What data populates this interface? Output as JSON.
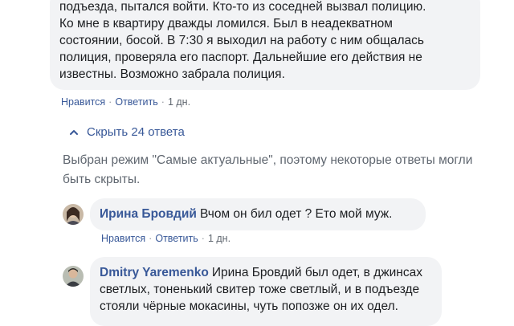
{
  "comment1": {
    "lines": [
      "подъезда, пытался войти. Кто-то из соседней вызвал полицию.",
      "Ко мне в квартиру дважды ломился. Был в неадекватном",
      "состоянии, босой. В 7:30 я выходил на работу с ним общалась",
      "полиция, проверяла его паспорт. Дальнейшие его действия не",
      "известны. Возможно забрала полиция."
    ],
    "like": "Нравится",
    "reply": "Ответить",
    "time": "1 дн."
  },
  "hide_replies": "Скрыть 24 ответа",
  "notice": "Выбран режим \"Самые актуальные\", поэтому некоторые ответы могли быть скрыты.",
  "reply1": {
    "author": "Ирина Бровдий",
    "text": "Вчом он бил одет ? Ето мой муж.",
    "like": "Нравится",
    "reply": "Ответить",
    "time": "1 дн."
  },
  "reply2": {
    "author": "Dmitry Yaremenko",
    "lines": [
      "Ирина Бровдий был одет, в джинсах",
      "светлых, тоненький свитер тоже светлый, и в подъезде",
      "стояли чёрные мокасины, чуть попозже он их одел."
    ]
  },
  "colors": {
    "link": "#385898",
    "bubble": "#f2f3f5",
    "muted": "#606770"
  }
}
